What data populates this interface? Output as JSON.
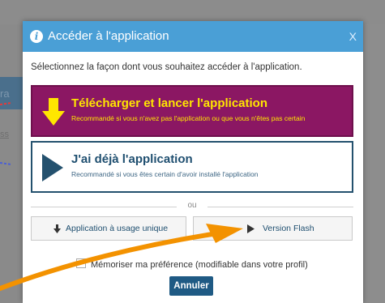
{
  "background": {
    "left_text": "ra",
    "left_text2": "ss"
  },
  "dialog": {
    "title": "Accéder à l'application",
    "close_label": "X",
    "instruction": "Sélectionnez la façon dont vous souhaitez accéder à l'application.",
    "option_download": {
      "title": "Télécharger et lancer l'application",
      "subtitle": "Recommandé si vous n'avez pas l'application ou que vous n'êtes pas certain"
    },
    "option_installed": {
      "title": "J'ai déjà l'application",
      "subtitle": "Recommandé si vous êtes certain d'avoir installé l'application"
    },
    "separator": "ou",
    "single_use_label": "Application à usage unique",
    "flash_label": "Version Flash",
    "remember_label": "Mémoriser ma préférence (modifiable dans votre profil)",
    "cancel_label": "Annuler"
  },
  "colors": {
    "header": "#4a9fd6",
    "download_bg": "#8b1763",
    "download_text": "#ffe600",
    "installed_text": "#1f4f70",
    "annotation_arrow": "#f39200"
  }
}
